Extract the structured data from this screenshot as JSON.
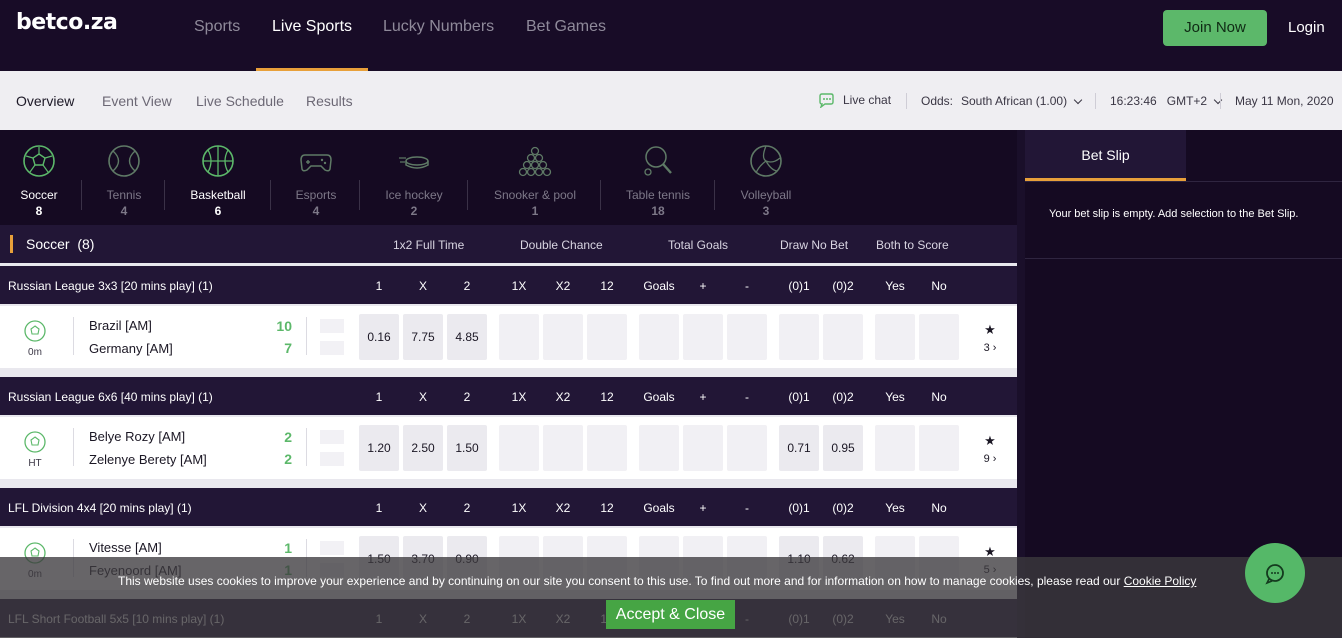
{
  "brand": {
    "logo": "betco.za",
    "accent": "#e8a03a",
    "green": "#5cb86a"
  },
  "topnav": {
    "items": [
      "Sports",
      "Live Sports",
      "Lucky Numbers",
      "Bet Games"
    ],
    "active": "Live Sports",
    "join_label": "Join Now",
    "login_label": "Login"
  },
  "subnav": {
    "items": [
      "Overview",
      "Event View",
      "Live Schedule",
      "Results"
    ],
    "live_chat": "Live chat",
    "odds_label": "Odds:",
    "odds_value": "South African (1.00)",
    "time": "16:23:46",
    "tz": "GMT+2",
    "date": "May 11 Mon, 2020"
  },
  "sports": [
    {
      "name": "Soccer",
      "count": "8",
      "icon": "soccer-ball-icon"
    },
    {
      "name": "Tennis",
      "count": "4",
      "icon": "tennis-ball-icon"
    },
    {
      "name": "Basketball",
      "count": "6",
      "icon": "basketball-icon"
    },
    {
      "name": "Esports",
      "count": "4",
      "icon": "gamepad-icon"
    },
    {
      "name": "Ice hockey",
      "count": "2",
      "icon": "hockey-puck-icon"
    },
    {
      "name": "Snooker & pool",
      "count": "1",
      "icon": "snooker-balls-icon"
    },
    {
      "name": "Table tennis",
      "count": "18",
      "icon": "table-tennis-icon"
    },
    {
      "name": "Volleyball",
      "count": "3",
      "icon": "volleyball-icon"
    }
  ],
  "section": {
    "title": "Soccer",
    "count": "(8)",
    "groups": [
      "1x2 Full Time",
      "Double Chance",
      "Total Goals",
      "Draw No Bet",
      "Both to Score"
    ]
  },
  "market_cols": [
    "1",
    "X",
    "2",
    "1X",
    "X2",
    "12",
    "Goals",
    "+",
    "-",
    "(0)1",
    "(0)2",
    "Yes",
    "No"
  ],
  "leagues": [
    {
      "name": "Russian League 3x3 [20 mins play] (1)",
      "match": {
        "time": "0m",
        "home": "Brazil [AM]",
        "away": "Germany [AM]",
        "home_score": "10",
        "away_score": "7",
        "odds": [
          "0.16",
          "7.75",
          "4.85",
          "",
          "",
          "",
          "",
          "",
          "",
          "",
          "",
          "",
          ""
        ],
        "more": "3"
      }
    },
    {
      "name": "Russian League 6x6 [40 mins play] (1)",
      "match": {
        "time": "HT",
        "home": "Belye Rozy [AM]",
        "away": "Zelenye Berety [AM]",
        "home_score": "2",
        "away_score": "2",
        "odds": [
          "1.20",
          "2.50",
          "1.50",
          "",
          "",
          "",
          "",
          "",
          "",
          "0.71",
          "0.95",
          "",
          ""
        ],
        "more": "9"
      }
    },
    {
      "name": "LFL Division 4x4 [20 mins play] (1)",
      "match": {
        "time": "0m",
        "home": "Vitesse [AM]",
        "away": "Feyenoord [AM]",
        "home_score": "1",
        "away_score": "1",
        "odds": [
          "1.50",
          "3.70",
          "0.90",
          "",
          "",
          "",
          "",
          "",
          "",
          "1.10",
          "0.62",
          "",
          ""
        ],
        "more": "5"
      }
    },
    {
      "name": "LFL Short Football 5x5 [10 mins play] (1)"
    }
  ],
  "betslip": {
    "tab": "Bet Slip",
    "empty_msg": "Your bet slip is empty. Add selection to the Bet Slip."
  },
  "cookie": {
    "text": "This website uses cookies to improve your experience and by continuing on our site you consent to this use. To find out more and for information on how to manage cookies, please read our ",
    "link": "Cookie Policy",
    "accept": "Accept & Close"
  }
}
